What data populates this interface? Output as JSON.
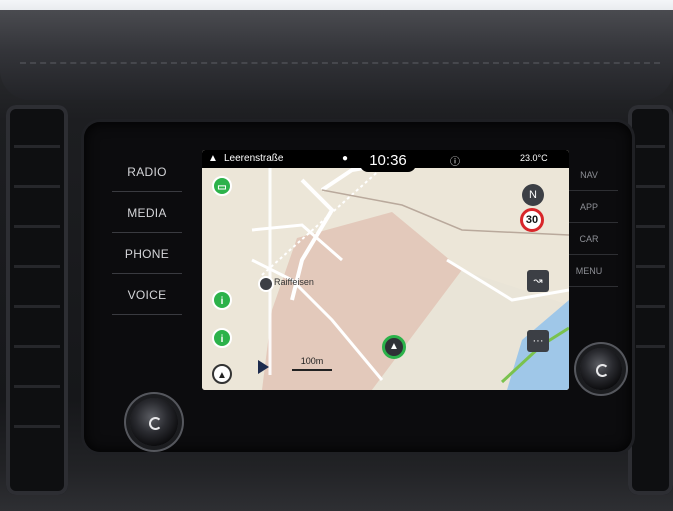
{
  "hardware_left": {
    "buttons": [
      "RADIO",
      "MEDIA",
      "PHONE",
      "VOICE"
    ]
  },
  "hardware_right": {
    "buttons": [
      "NAV",
      "APP",
      "CAR",
      "MENU"
    ]
  },
  "status": {
    "street": "Leerenstraße",
    "time": "10:36",
    "temperature": "23.0",
    "temperature_unit": "°C"
  },
  "map": {
    "place_label": "Raiffeisen",
    "scale": "100m",
    "speed_limit": "30",
    "compass": "N"
  },
  "icons": {
    "poi_top": "fuel-pump-icon",
    "poi_mid1": "restaurant-icon",
    "poi_mid2": "restaurant-icon",
    "route_start": "compass-arrow-icon",
    "play": "play-icon",
    "position": "vehicle-arrow-icon",
    "traffic": "traffic-icon",
    "info": "info-icon"
  },
  "colors": {
    "poi_green": "#2cb24a",
    "speed_red": "#d8262a",
    "screen_bg": "#e9e3d6"
  }
}
